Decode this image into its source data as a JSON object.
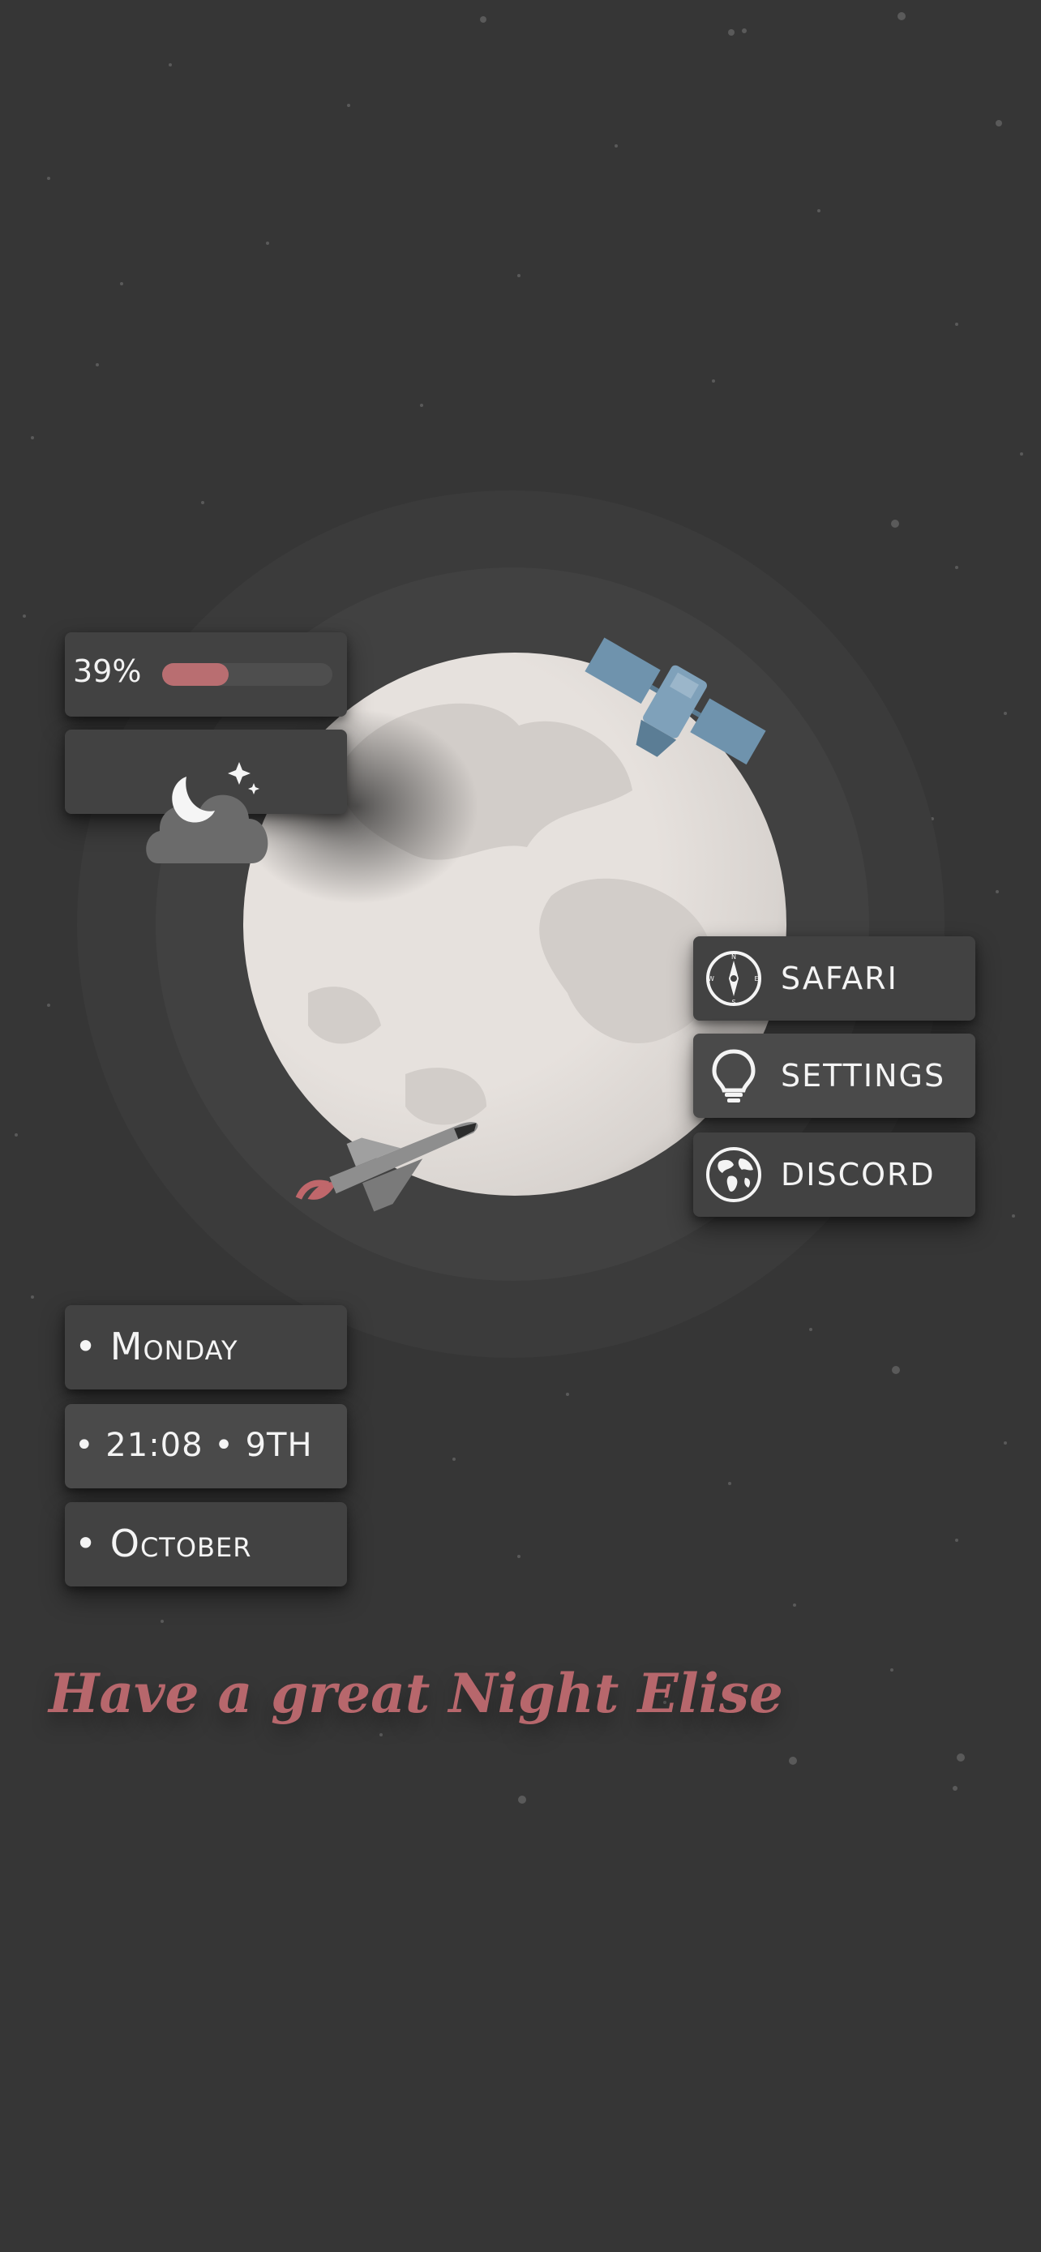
{
  "battery": {
    "percent_text": "39%",
    "level": 0.39,
    "fill_color": "#b96e71"
  },
  "weather": {
    "icon": "cloud-moon-icon"
  },
  "apps": [
    {
      "label": "SAFARI",
      "icon": "compass-icon"
    },
    {
      "label": "SETTINGS",
      "icon": "lightbulb-icon"
    },
    {
      "label": "DISCORD",
      "icon": "globe-icon"
    }
  ],
  "date": {
    "day": "• Monday",
    "time_date": "• 21:08 • 9TH",
    "month": "• October"
  },
  "greeting": "Have a great Night Elise",
  "colors": {
    "background": "#363636",
    "widget": "#424242",
    "accent": "#b96e71",
    "moon": "#e5e0dc",
    "satellite": "#6f93ad"
  },
  "decor": {
    "moon": "moon-illustration",
    "satellite": "satellite-icon",
    "shuttle": "space-shuttle-icon"
  }
}
